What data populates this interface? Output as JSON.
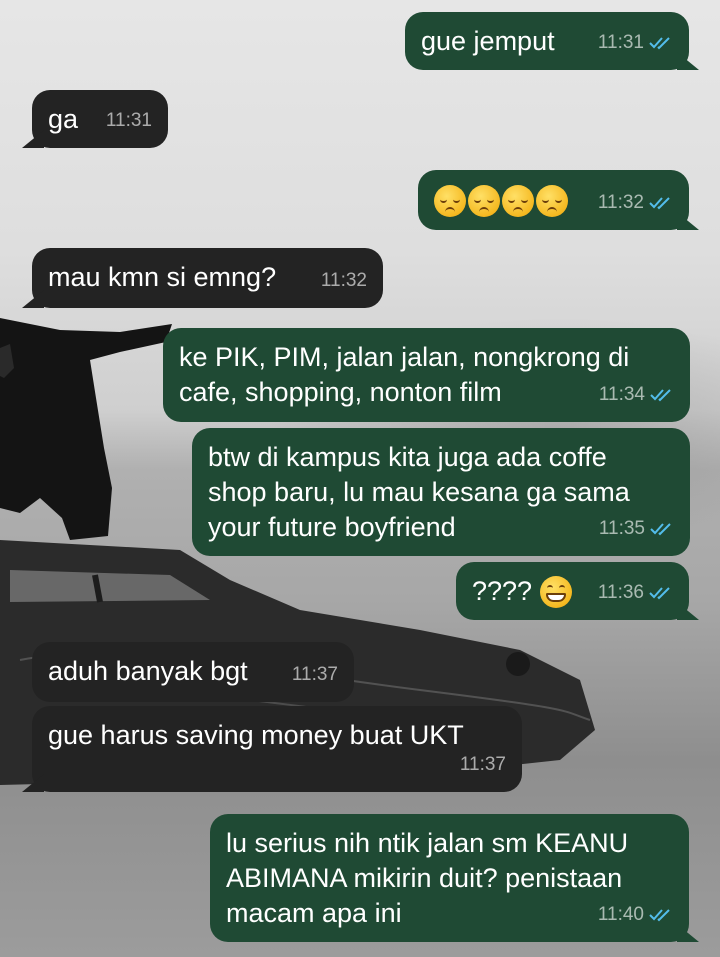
{
  "colors": {
    "outgoing_bubble": "#1f4a34",
    "incoming_bubble": "#232323",
    "read_tick": "#53bdeb",
    "text": "#ffffff"
  },
  "messages": [
    {
      "direction": "out",
      "text": "gue jemput",
      "time": "11:31",
      "read": true
    },
    {
      "direction": "in",
      "text": "ga",
      "time": "11:31"
    },
    {
      "direction": "out",
      "emoji": [
        "pensive-face-icon",
        "pensive-face-icon",
        "pensive-face-icon",
        "pensive-face-icon"
      ],
      "time": "11:32",
      "read": true
    },
    {
      "direction": "in",
      "text": "mau kmn si emng?",
      "time": "11:32"
    },
    {
      "direction": "out",
      "text": "ke PIK, PIM, jalan jalan, nongkrong di\ncafe, shopping, nonton film",
      "time": "11:34",
      "read": true
    },
    {
      "direction": "out",
      "text": "btw di kampus kita juga ada coffe\nshop baru, lu mau kesana ga sama\nyour future boyfriend",
      "time": "11:35",
      "read": true
    },
    {
      "direction": "out",
      "text": "????",
      "emoji": [
        "grinning-face-icon"
      ],
      "time": "11:36",
      "read": true
    },
    {
      "direction": "in",
      "text": "aduh banyak bgt",
      "time": "11:37"
    },
    {
      "direction": "in",
      "text": "gue harus saving money buat UKT",
      "time": "11:37"
    },
    {
      "direction": "out",
      "text": "lu serius nih ntik jalan sm KEANU\nABIMANA mikirin duit? penistaan\nmacam apa ini",
      "time": "11:40",
      "read": true
    }
  ]
}
